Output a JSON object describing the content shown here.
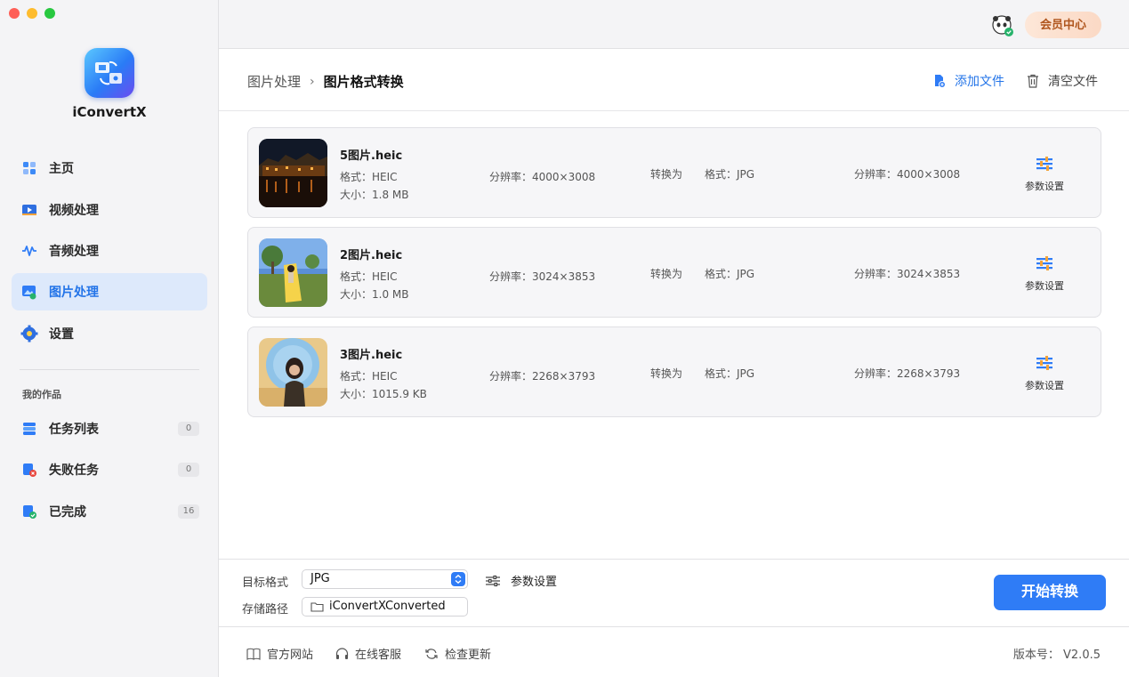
{
  "app": {
    "name": "iConvertX"
  },
  "sidebar": {
    "items": [
      {
        "label": "主页",
        "icon": "home-icon"
      },
      {
        "label": "视频处理",
        "icon": "video-icon"
      },
      {
        "label": "音频处理",
        "icon": "audio-wave-icon"
      },
      {
        "label": "图片处理",
        "icon": "image-icon",
        "active": true
      },
      {
        "label": "设置",
        "icon": "gear-icon"
      }
    ],
    "section_label": "我的作品",
    "works": [
      {
        "label": "任务列表",
        "count": "0",
        "icon": "task-list-icon"
      },
      {
        "label": "失败任务",
        "count": "0",
        "icon": "failed-task-icon"
      },
      {
        "label": "已完成",
        "count": "16",
        "icon": "completed-icon"
      }
    ]
  },
  "topbar": {
    "member_label": "会员中心"
  },
  "header": {
    "crumb_parent": "图片处理",
    "crumb_separator": "›",
    "crumb_current": "图片格式转换",
    "add_label": "添加文件",
    "clear_label": "清空文件"
  },
  "files": [
    {
      "name": "5图片.heic",
      "format": "格式：HEIC",
      "size": "大小：1.8 MB",
      "resolution": "分辨率：4000×3008",
      "convert_to": "转换为",
      "target_format": "格式：JPG",
      "target_resolution": "分辨率：4000×3008",
      "params_label": "参数设置"
    },
    {
      "name": "2图片.heic",
      "format": "格式：HEIC",
      "size": "大小：1.0 MB",
      "resolution": "分辨率：3024×3853",
      "convert_to": "转换为",
      "target_format": "格式：JPG",
      "target_resolution": "分辨率：3024×3853",
      "params_label": "参数设置"
    },
    {
      "name": "3图片.heic",
      "format": "格式：HEIC",
      "size": "大小：1015.9 KB",
      "resolution": "分辨率：2268×3793",
      "convert_to": "转换为",
      "target_format": "格式：JPG",
      "target_resolution": "分辨率：2268×3793",
      "params_label": "参数设置"
    }
  ],
  "bottom": {
    "target_label": "目标格式",
    "target_value": "JPG",
    "params_label": "参数设置",
    "path_label": "存储路径",
    "path_value": "iConvertXConverted",
    "start_label": "开始转换"
  },
  "footer": {
    "website": "官方网站",
    "support": "在线客服",
    "update": "检查更新",
    "version": "版本号：  V2.0.5"
  },
  "colors": {
    "accent": "#2f7cf6",
    "active_bg": "#dde9fb",
    "member_text": "#b0561e"
  }
}
